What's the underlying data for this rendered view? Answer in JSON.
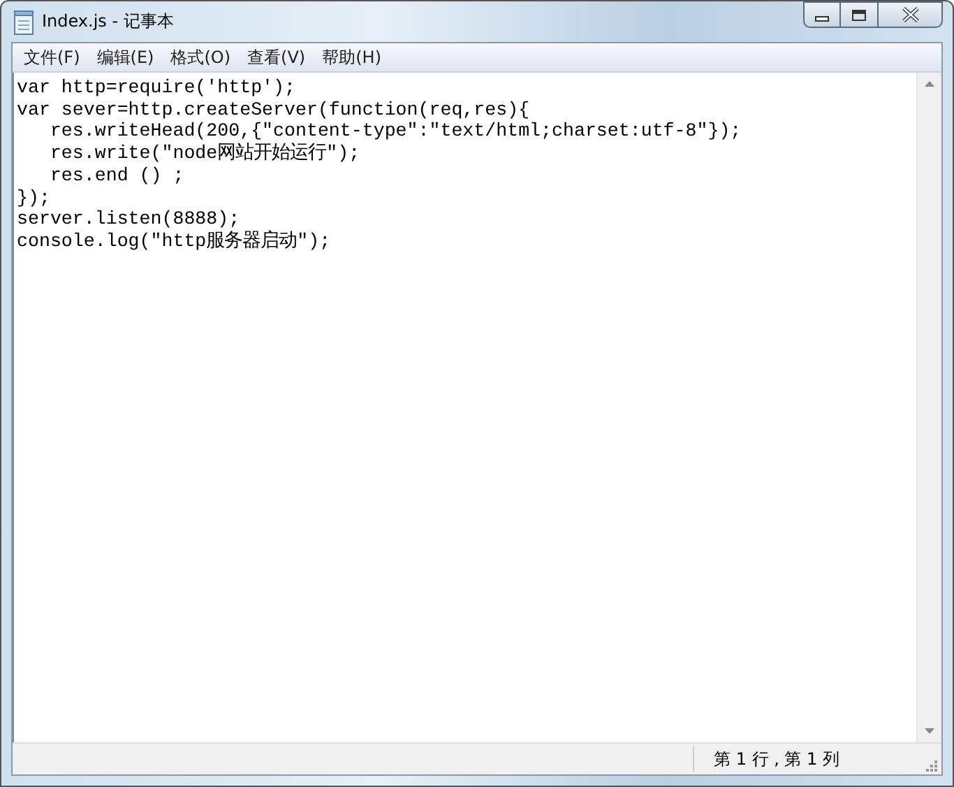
{
  "window": {
    "title": "Index.js - 记事本"
  },
  "menu": [
    {
      "label": "文件(F)"
    },
    {
      "label": "编辑(E)"
    },
    {
      "label": "格式(O)"
    },
    {
      "label": "查看(V)"
    },
    {
      "label": "帮助(H)"
    }
  ],
  "editor": {
    "lines": [
      "var http=require('http');",
      "var sever=http.createServer(function(req,res){",
      "   res.writeHead(200,{\"content-type\":\"text/html;charset:utf-8\"});",
      "   res.write(\"node网站开始运行\");",
      "   res.end () ;",
      "});",
      "server.listen(8888);",
      "console.log(\"http服务器启动\");"
    ]
  },
  "status_bar": {
    "position": "第 1 行 , 第 1 列"
  }
}
